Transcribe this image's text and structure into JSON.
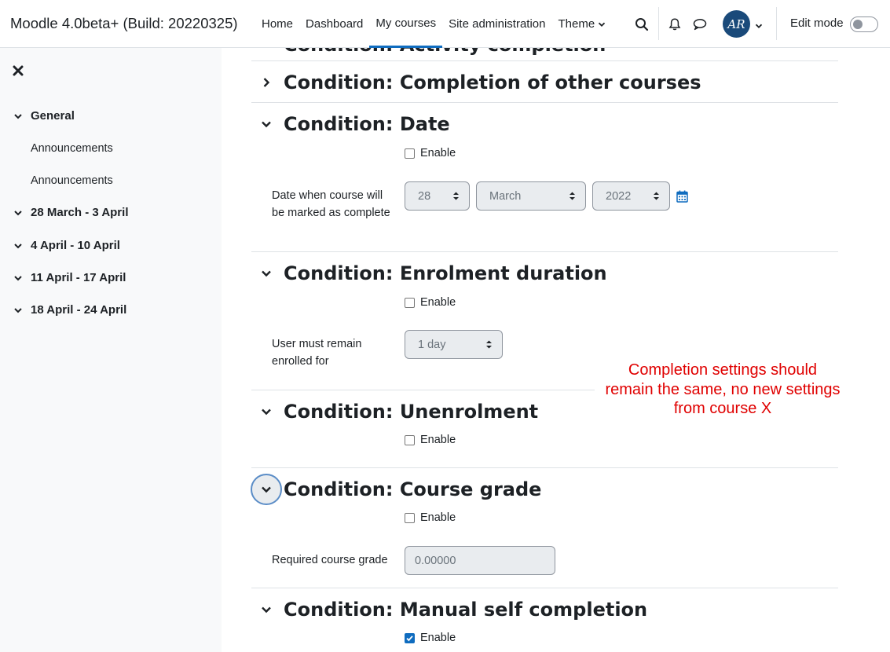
{
  "navbar": {
    "site_name": "Moodle 4.0beta+ (Build: 20220325)",
    "links": [
      "Home",
      "Dashboard",
      "My courses",
      "Site administration",
      "Theme"
    ],
    "active_link": "My courses",
    "avatar_initials": "AR",
    "edit_mode_label": "Edit mode",
    "edit_mode_on": false
  },
  "drawer": {
    "items": [
      {
        "type": "section",
        "label": "General"
      },
      {
        "type": "activity",
        "label": "Announcements"
      },
      {
        "type": "activity",
        "label": "Announcements"
      },
      {
        "type": "section",
        "label": "28 March - 3 April"
      },
      {
        "type": "section",
        "label": "4 April - 10 April"
      },
      {
        "type": "section",
        "label": "11 April - 17 April"
      },
      {
        "type": "section",
        "label": "18 April - 24 April"
      }
    ]
  },
  "main": {
    "partial_heading": "Condition: Activity completion",
    "sections": {
      "other_courses": {
        "title": "Condition: Completion of other courses",
        "expanded": false
      },
      "date": {
        "title": "Condition: Date",
        "enable_label": "Enable",
        "enabled": false,
        "field_label": "Date when course will be marked as complete",
        "day": "28",
        "month": "March",
        "year": "2022"
      },
      "enrolment_duration": {
        "title": "Condition: Enrolment duration",
        "enable_label": "Enable",
        "enabled": false,
        "field_label": "User must remain enrolled for",
        "value": "1 day"
      },
      "unenrolment": {
        "title": "Condition: Unenrolment",
        "enable_label": "Enable",
        "enabled": false
      },
      "course_grade": {
        "title": "Condition: Course grade",
        "enable_label": "Enable",
        "enabled": false,
        "field_label": "Required course grade",
        "value": "0.00000"
      },
      "manual_self": {
        "title": "Condition: Manual self completion",
        "enable_label": "Enable",
        "enabled": true
      }
    },
    "annotation": "Completion settings should remain the same, no new settings from course X"
  },
  "colors": {
    "primary": "#0f6cbf",
    "annotation": "#e00000",
    "drawer_bg": "#f8f9fa",
    "avatar_bg": "#1a4a7a"
  },
  "icons": [
    "search-icon",
    "bell-icon",
    "chat-icon",
    "chevron-down-icon",
    "chevron-right-icon",
    "close-icon",
    "calendar-icon",
    "checkmark-icon"
  ]
}
